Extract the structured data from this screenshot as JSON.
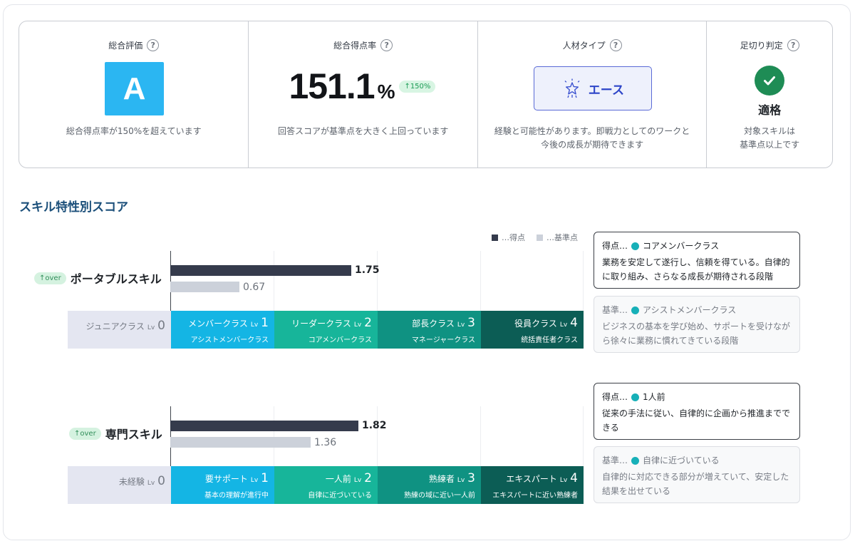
{
  "summary": {
    "overall": {
      "title": "総合評価",
      "grade": "A",
      "desc": "総合得点率が150%を超えています"
    },
    "rate": {
      "title": "総合得点率",
      "value": "151.1",
      "unit": "%",
      "badge": "↑150%",
      "desc": "回答スコアが基準点を大きく上回っています"
    },
    "type": {
      "title": "人材タイプ",
      "label": "エース",
      "icon": "star-burst-icon",
      "desc_line1": "経験と可能性があります。即戦力としてのワークと",
      "desc_line2": "今後の成長が期待できます"
    },
    "cutoff": {
      "title": "足切り判定",
      "label": "適格",
      "icon": "check-icon",
      "desc_line1": "対象スキルは",
      "desc_line2": "基準点以上です"
    }
  },
  "section_title": "スキル特性別スコア",
  "legend": {
    "score": "…得点",
    "base": "…基準点"
  },
  "colors": {
    "score_bar": "#353b4c",
    "base_bar": "#ccd1da",
    "lv1": "#14b5e4",
    "lv2": "#17b59a",
    "lv3": "#0f9282",
    "lv4": "#0c5d55",
    "dot": "#17b0b8"
  },
  "skills": [
    {
      "badge": "↑over",
      "name": "ポータブルスキル",
      "score": 1.75,
      "score_label": "1.75",
      "base": 0.67,
      "base_label": "0.67",
      "levels": [
        {
          "name": "ジュニアクラス",
          "lv": "Lv",
          "num": "0",
          "sub": ""
        },
        {
          "name": "メンバークラス",
          "lv": "Lv",
          "num": "1",
          "sub": "アシストメンバークラス"
        },
        {
          "name": "リーダークラス",
          "lv": "Lv",
          "num": "2",
          "sub": "コアメンバークラス"
        },
        {
          "name": "部長クラス",
          "lv": "Lv",
          "num": "3",
          "sub": "マネージャークラス"
        },
        {
          "name": "役員クラス",
          "lv": "Lv",
          "num": "4",
          "sub": "統括責任者クラス"
        }
      ],
      "score_info": {
        "prefix": "得点…",
        "label": "コアメンバークラス",
        "text": "業務を安定して遂行し、信頼を得ている。自律的に取り組み、さらなる成長が期待される段階"
      },
      "base_info": {
        "prefix": "基準…",
        "label": "アシストメンバークラス",
        "text": "ビジネスの基本を学び始め、サポートを受けながら徐々に業務に慣れてきている段階"
      }
    },
    {
      "badge": "↑over",
      "name": "専門スキル",
      "score": 1.82,
      "score_label": "1.82",
      "base": 1.36,
      "base_label": "1.36",
      "levels": [
        {
          "name": "未経験",
          "lv": "Lv",
          "num": "0",
          "sub": ""
        },
        {
          "name": "要サポート",
          "lv": "Lv",
          "num": "1",
          "sub": "基本の理解が進行中"
        },
        {
          "name": "一人前",
          "lv": "Lv",
          "num": "2",
          "sub": "自律に近づいている"
        },
        {
          "name": "熟練者",
          "lv": "Lv",
          "num": "3",
          "sub": "熟練の域に近い一人前"
        },
        {
          "name": "エキスパート",
          "lv": "Lv",
          "num": "4",
          "sub": "エキスパートに近い熟練者"
        }
      ],
      "score_info": {
        "prefix": "得点…",
        "label": "1人前",
        "text": "従来の手法に従い、自律的に企画から推進までできる"
      },
      "base_info": {
        "prefix": "基準…",
        "label": "自律に近づいている",
        "text": "自律的に対応できる部分が増えていて、安定した結果を出せている"
      }
    }
  ]
}
